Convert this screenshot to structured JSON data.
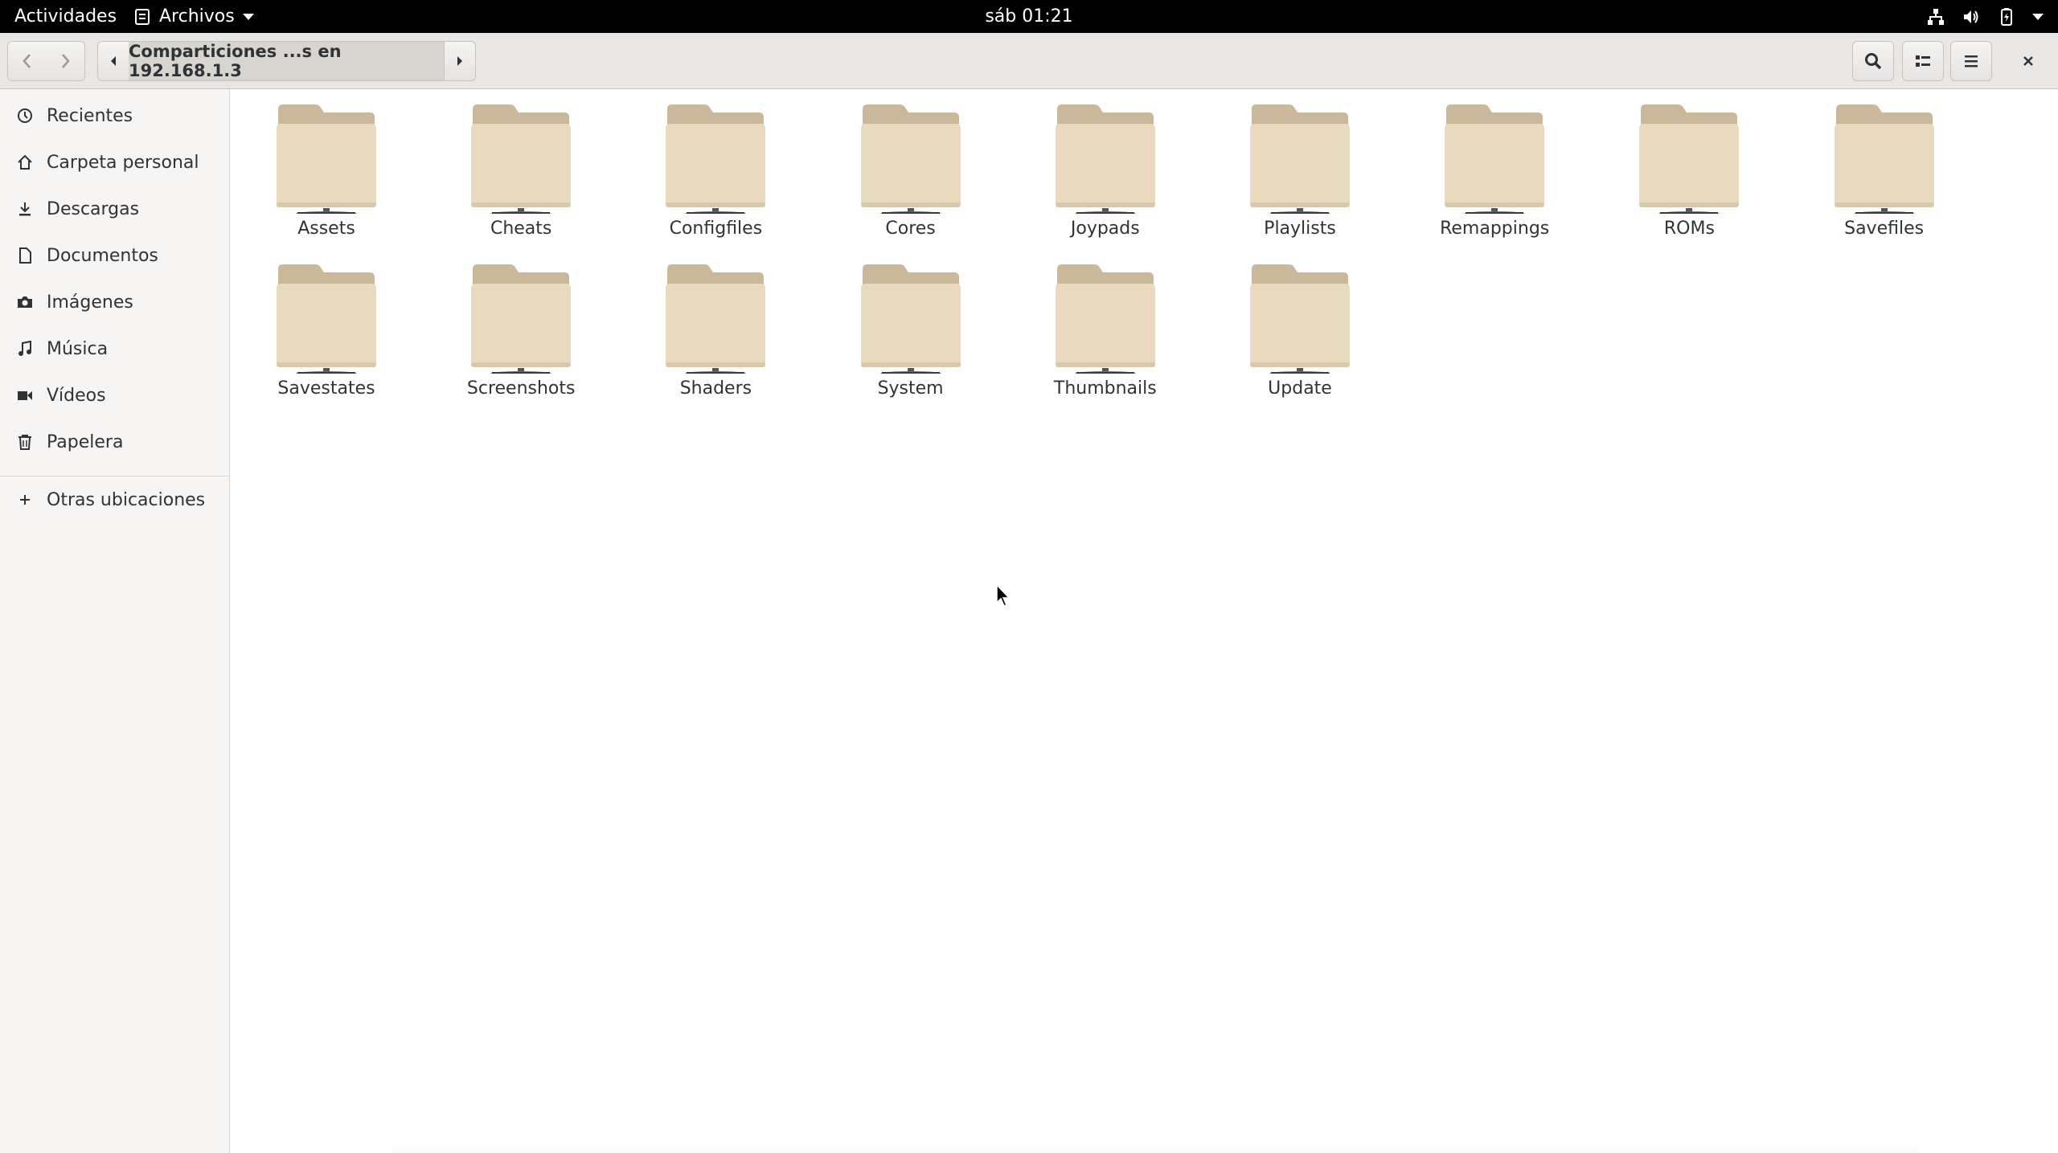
{
  "topbar": {
    "activities": "Actividades",
    "app_name": "Archivos",
    "clock": "sáb 01:21"
  },
  "headerbar": {
    "path_label": "Comparticiones ...s en 192.168.1.3"
  },
  "sidebar": {
    "items": [
      {
        "label": "Recientes",
        "icon": "clock-icon"
      },
      {
        "label": "Carpeta personal",
        "icon": "home-icon"
      },
      {
        "label": "Descargas",
        "icon": "download-icon"
      },
      {
        "label": "Documentos",
        "icon": "document-icon"
      },
      {
        "label": "Imágenes",
        "icon": "camera-icon"
      },
      {
        "label": "Música",
        "icon": "music-icon"
      },
      {
        "label": "Vídeos",
        "icon": "film-icon"
      },
      {
        "label": "Papelera",
        "icon": "trash-icon"
      }
    ],
    "other_locations": "Otras ubicaciones"
  },
  "folders": [
    "Assets",
    "Cheats",
    "Configfiles",
    "Cores",
    "Joypads",
    "Playlists",
    "Remappings",
    "ROMs",
    "Savefiles",
    "Savestates",
    "Screenshots",
    "Shaders",
    "System",
    "Thumbnails",
    "Update"
  ],
  "colors": {
    "topbar_bg": "#000000",
    "headerbar_bg": "#e9e7e5",
    "sidebar_bg": "#f6f5f4",
    "folder_body": "#e8d9bf",
    "folder_tab": "#c9b89a"
  }
}
